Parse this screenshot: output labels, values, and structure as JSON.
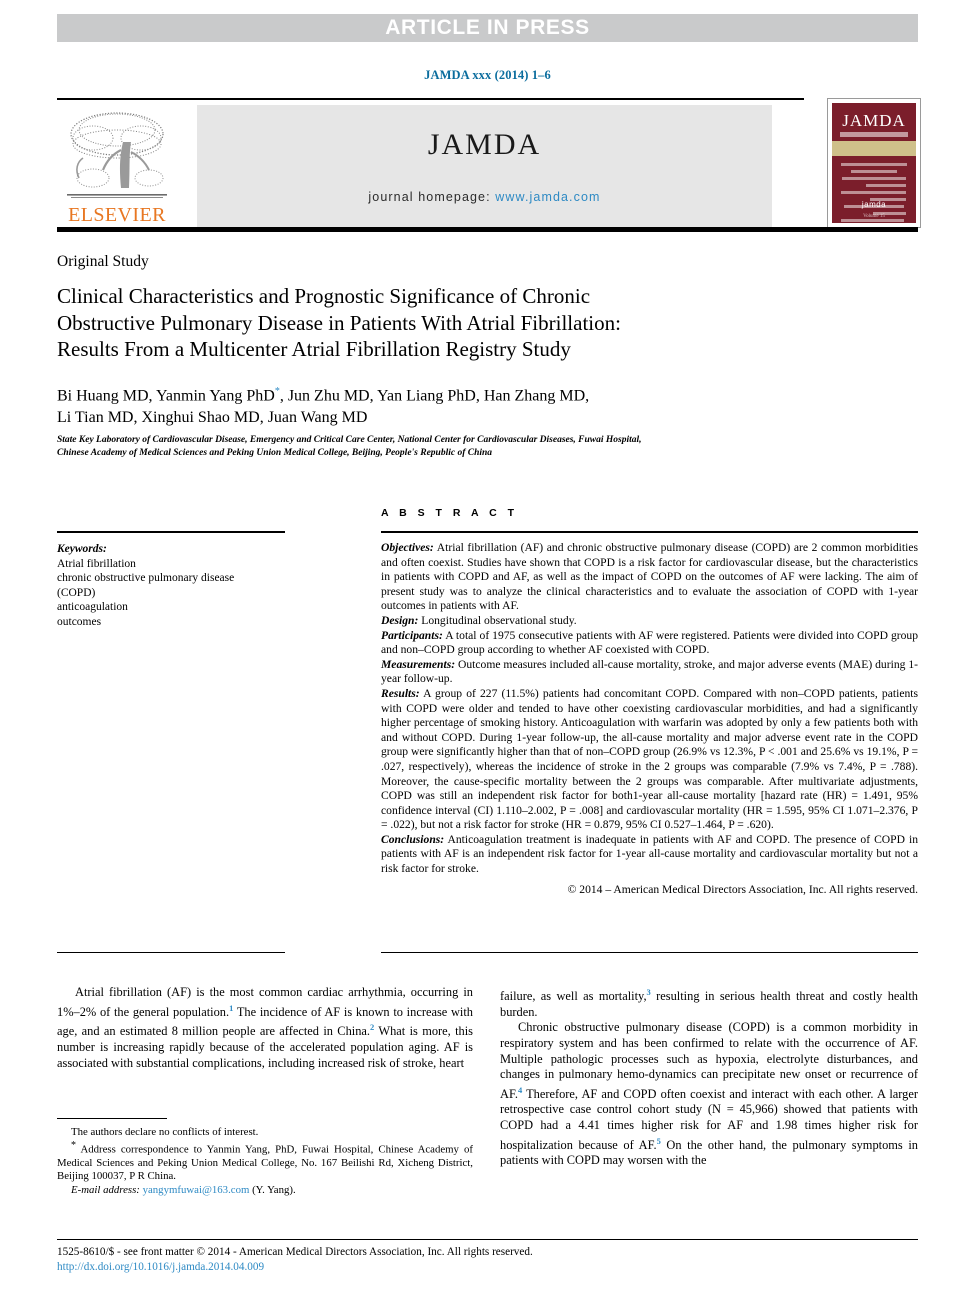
{
  "header": {
    "article_in_press": "ARTICLE IN PRESS",
    "journal_ref": "JAMDA xxx (2014) 1–6",
    "elsevier_label": "ELSEVIER",
    "journal_wordmark": "JAMDA",
    "homepage_prefix": "journal homepage:",
    "homepage_url": "www.jamda.com",
    "cover": {
      "title": "JAMDA",
      "logo": "jamda",
      "bottom": "Volume 15"
    }
  },
  "article": {
    "section_label": "Original Study",
    "title_line1": "Clinical Characteristics and Prognostic Significance of Chronic",
    "title_line2": "Obstructive Pulmonary Disease in Patients With Atrial Fibrillation:",
    "title_line3": "Results From a Multicenter Atrial Fibrillation Registry Study",
    "authors_part1": "Bi Huang MD, Yanmin Yang PhD",
    "authors_part2": ", Jun Zhu MD, Yan Liang PhD, Han Zhang MD,",
    "authors_line2": "Li Tian MD, Xinghui Shao MD, Juan Wang MD",
    "affiliation_line1": "State Key Laboratory of Cardiovascular Disease, Emergency and Critical Care Center, National Center for Cardiovascular Diseases, Fuwai Hospital,",
    "affiliation_line2": "Chinese Academy of Medical Sciences and Peking Union Medical College, Beijing, People's Republic of China"
  },
  "keywords": {
    "heading": "Keywords:",
    "items": [
      "Atrial fibrillation",
      "chronic obstructive pulmonary disease",
      "(COPD)",
      "anticoagulation",
      "outcomes"
    ]
  },
  "abstract": {
    "heading": "A B S T R A C T",
    "objectives_label": "Objectives:",
    "objectives_text": " Atrial fibrillation (AF) and chronic obstructive pulmonary disease (COPD) are 2 common morbidities and often coexist. Studies have shown that COPD is a risk factor for cardiovascular disease, but the characteristics in patients with COPD and AF, as well as the impact of COPD on the outcomes of AF were lacking. The aim of present study was to analyze the clinical characteristics and to evaluate the association of COPD with 1-year outcomes in patients with AF.",
    "design_label": "Design:",
    "design_text": " Longitudinal observational study.",
    "participants_label": "Participants:",
    "participants_text": " A total of 1975 consecutive patients with AF were registered. Patients were divided into COPD group and non–COPD group according to whether AF coexisted with COPD.",
    "measurements_label": "Measurements:",
    "measurements_text": " Outcome measures included all-cause mortality, stroke, and major adverse events (MAE) during 1-year follow-up.",
    "results_label": "Results:",
    "results_text": " A group of 227 (11.5%) patients had concomitant COPD. Compared with non–COPD patients, patients with COPD were older and tended to have other coexisting cardiovascular morbidities, and had a significantly higher percentage of smoking history. Anticoagulation with warfarin was adopted by only a few patients both with and without COPD. During 1-year follow-up, the all-cause mortality and major adverse event rate in the COPD group were significantly higher than that of non–COPD group (26.9% vs 12.3%, P < .001 and 25.6% vs 19.1%, P = .027, respectively), whereas the incidence of stroke in the 2 groups was comparable (7.9% vs 7.4%, P = .788). Moreover, the cause-specific mortality between the 2 groups was comparable. After multivariate adjustments, COPD was still an independent risk factor for both1-year all-cause mortality [hazard rate (HR) = 1.491, 95% confidence interval (CI) 1.110–2.002, P = .008] and cardiovascular mortality (HR = 1.595, 95% CI 1.071–2.376, P = .022), but not a risk factor for stroke (HR = 0.879, 95% CI 0.527–1.464, P = .620).",
    "conclusions_label": "Conclusions:",
    "conclusions_text": " Anticoagulation treatment is inadequate in patients with AF and COPD. The presence of COPD in patients with AF is an independent risk factor for 1-year all-cause mortality and cardiovascular mortality but not a risk factor for stroke.",
    "copyright": "© 2014 – American Medical Directors Association, Inc. All rights reserved."
  },
  "body": {
    "left_para_a": "Atrial fibrillation (AF) is the most common cardiac arrhythmia, occurring in 1%–2% of the general population.",
    "left_para_a_ref1": "1",
    "left_para_b": " The incidence of AF is known to increase with age, and an estimated 8 million people are affected in China.",
    "left_para_b_ref2": "2",
    "left_para_c": " What is more, this number is increasing rapidly because of the accelerated population aging. AF is associated with substantial complications, including increased risk of stroke, heart",
    "right_para_a": "failure, as well as mortality,",
    "right_para_a_ref3": "3",
    "right_para_b": " resulting in serious health threat and costly health burden.",
    "right_para_c": "Chronic obstructive pulmonary disease (COPD) is a common morbidity in respiratory system and has been confirmed to relate with the occurrence of AF. Multiple pathologic processes such as hypoxia, electrolyte disturbances, and changes in pulmonary hemo-dynamics can precipitate new onset or recurrence of AF.",
    "right_para_c_ref4": "4",
    "right_para_d": " Therefore, AF and COPD often coexist and interact with each other. A larger retrospective case control cohort study (N = 45,966) showed that patients with COPD had a 4.41 times higher risk for AF and 1.98 times higher risk for hospitalization because of AF.",
    "right_para_d_ref5": "5",
    "right_para_e": " On the other hand, the pulmonary symptoms in patients with COPD may worsen with the"
  },
  "footnotes": {
    "conflicts": "The authors declare no conflicts of interest.",
    "correspondence_star": "*",
    "correspondence": " Address correspondence to Yanmin Yang, PhD, Fuwai Hospital, Chinese Academy of Medical Sciences and Peking Union Medical College, No. 167 Beilishi Rd, Xicheng District, Beijing 100037, P R China.",
    "email_label": "E-mail address:",
    "email_address": "yangymfuwai@163.com",
    "email_suffix": " (Y. Yang)."
  },
  "imprint": {
    "issn_line": "1525-8610/$ - see front matter © 2014 - American Medical Directors Association, Inc. All rights reserved.",
    "doi": "http://dx.doi.org/10.1016/j.jamda.2014.04.009"
  }
}
